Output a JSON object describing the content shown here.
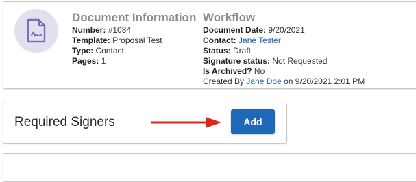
{
  "document_info": {
    "title": "Document Information",
    "rows": [
      {
        "label": "Number:",
        "value": "#1084"
      },
      {
        "label": "Template:",
        "value": "Proposal Test"
      },
      {
        "label": "Type:",
        "value": "Contact"
      },
      {
        "label": "Pages:",
        "value": "1"
      }
    ]
  },
  "workflow": {
    "title": "Workflow",
    "document_date_label": "Document Date:",
    "document_date": "9/20/2021",
    "contact_label": "Contact:",
    "contact": "Jane Tester",
    "status_label": "Status:",
    "status": "Draft",
    "signature_status_label": "Signature status:",
    "signature_status": "Not Requested",
    "archived_label": "Is Archived?",
    "archived": "No",
    "created_by_prefix": "Created By",
    "created_by": "Jane Doe",
    "created_on": "on 9/20/2021 2:01 PM"
  },
  "signers": {
    "title": "Required Signers",
    "add_label": "Add"
  },
  "icons": {
    "document": "document-signature-icon",
    "arrow": "red-arrow-right"
  },
  "colors": {
    "accent": "#1f68b8",
    "link": "#1f5fa8",
    "arrow": "#e0251b",
    "avatar_bg": "#e2e0ef",
    "icon": "#7b6fb8"
  }
}
